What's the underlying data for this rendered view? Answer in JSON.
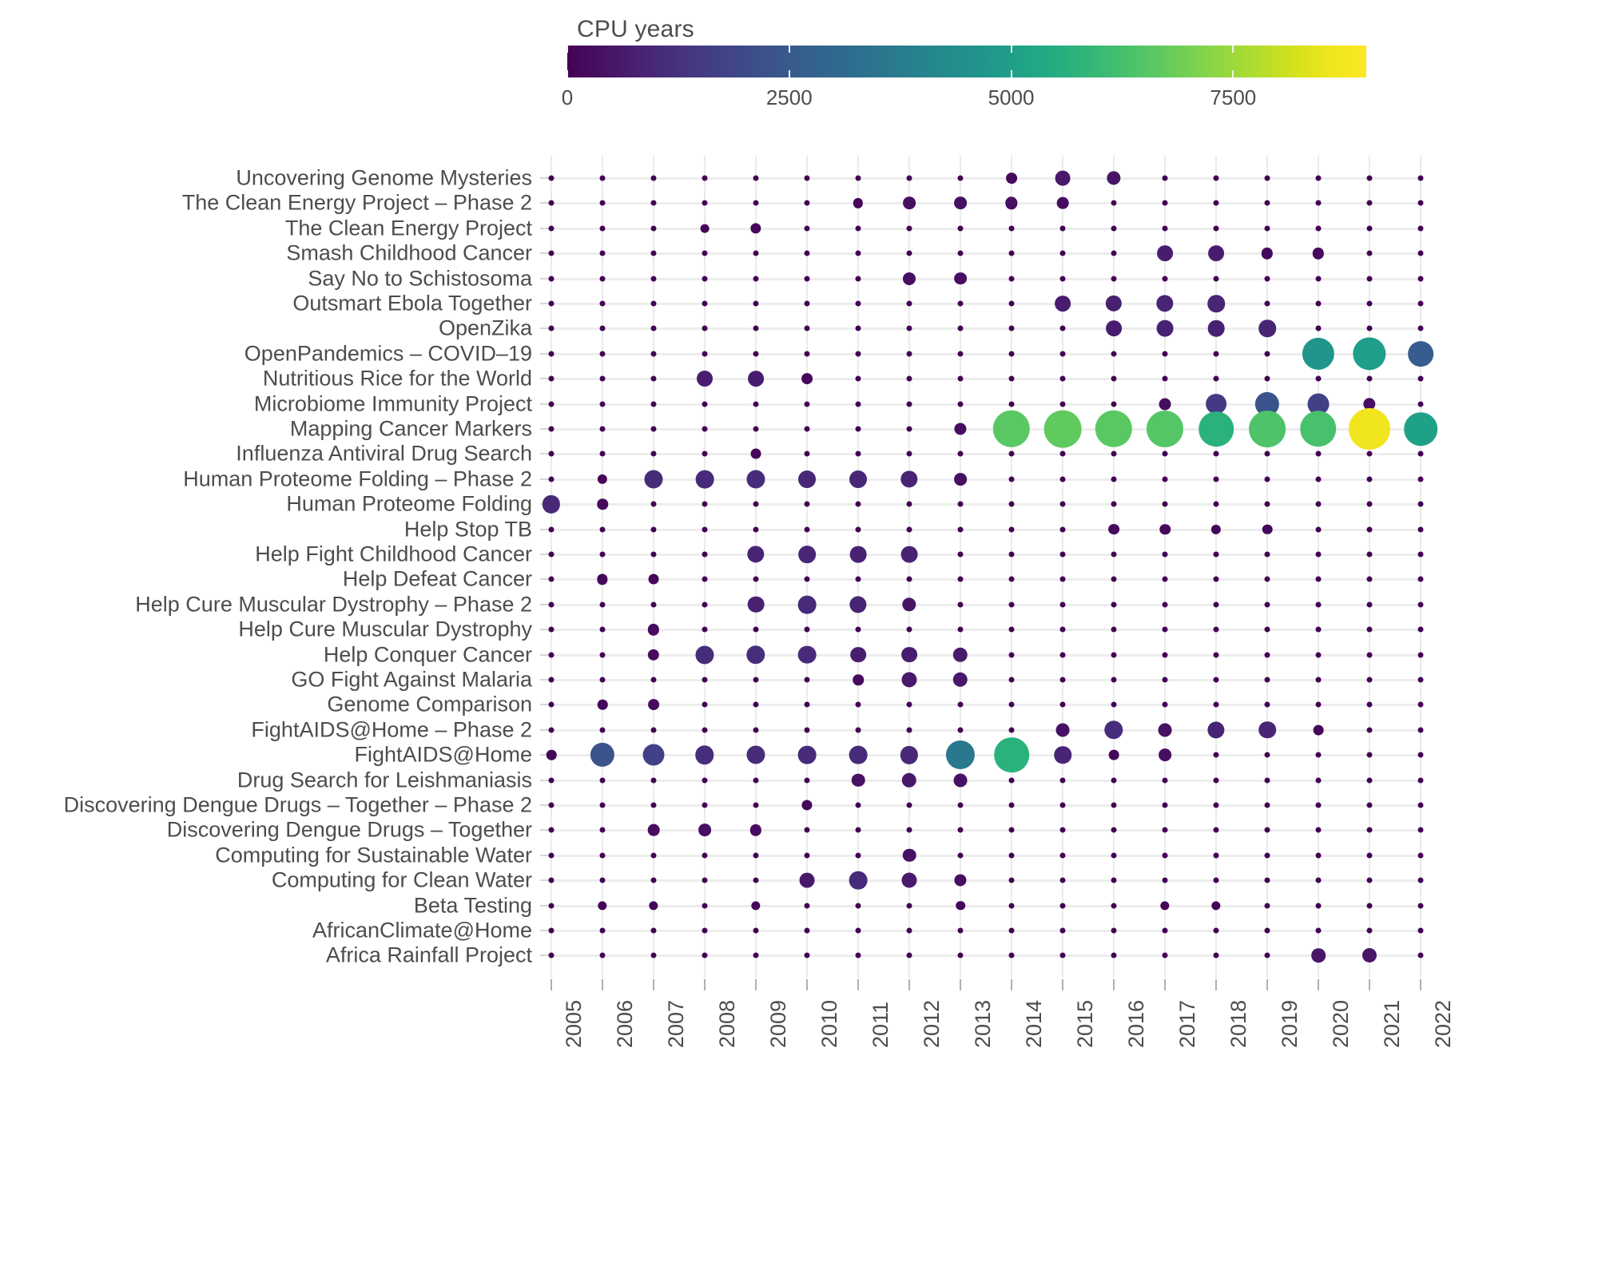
{
  "legend": {
    "title": "CPU years",
    "ticks": [
      0,
      2500,
      5000,
      7500
    ],
    "tick_labels": [
      "0",
      "2500",
      "5000",
      "7500"
    ],
    "range": [
      0,
      9000
    ],
    "colormap": "viridis",
    "colors": [
      "#440154",
      "#46327e",
      "#365c8d",
      "#277f8e",
      "#1fa187",
      "#4ac16d",
      "#a0da39",
      "#fde725"
    ]
  },
  "axes": {
    "x_label": "",
    "y_label": "",
    "x_ticks": [
      "2005",
      "2006",
      "2007",
      "2008",
      "2009",
      "2010",
      "2011",
      "2012",
      "2013",
      "2014",
      "2015",
      "2016",
      "2017",
      "2018",
      "2019",
      "2020",
      "2021",
      "2022"
    ],
    "y_ticks": [
      "Uncovering Genome Mysteries",
      "The Clean Energy Project – Phase 2",
      "The Clean Energy Project",
      "Smash Childhood Cancer",
      "Say No to Schistosoma",
      "Outsmart Ebola Together",
      "OpenZika",
      "OpenPandemics – COVID–19",
      "Nutritious Rice for the World",
      "Microbiome Immunity Project",
      "Mapping Cancer Markers",
      "Influenza Antiviral Drug Search",
      "Human Proteome Folding – Phase 2",
      "Human Proteome Folding",
      "Help Stop TB",
      "Help Fight Childhood Cancer",
      "Help Defeat Cancer",
      "Help Cure Muscular Dystrophy – Phase 2",
      "Help Cure Muscular Dystrophy",
      "Help Conquer Cancer",
      "GO Fight Against Malaria",
      "Genome Comparison",
      "FightAIDS@Home – Phase 2",
      "FightAIDS@Home",
      "Drug Search for Leishmaniasis",
      "Discovering Dengue Drugs – Together – Phase 2",
      "Discovering Dengue Drugs – Together",
      "Computing for Sustainable Water",
      "Computing for Clean Water",
      "Beta Testing",
      "AfricanClimate@Home",
      "Africa Rainfall Project"
    ]
  },
  "chart_data": {
    "type": "scatter",
    "title": "",
    "subtitle": "",
    "xlabel": "",
    "ylabel": "",
    "legend_title": "CPU years",
    "legend_position": "top",
    "grid": true,
    "size_encodes": "CPU years",
    "color_encodes": "CPU years",
    "x": [
      "2005",
      "2006",
      "2007",
      "2008",
      "2009",
      "2010",
      "2011",
      "2012",
      "2013",
      "2014",
      "2015",
      "2016",
      "2017",
      "2018",
      "2019",
      "2020",
      "2021",
      "2022"
    ],
    "categories": [
      "Uncovering Genome Mysteries",
      "The Clean Energy Project – Phase 2",
      "The Clean Energy Project",
      "Smash Childhood Cancer",
      "Say No to Schistosoma",
      "Outsmart Ebola Together",
      "OpenZika",
      "OpenPandemics – COVID–19",
      "Nutritious Rice for the World",
      "Microbiome Immunity Project",
      "Mapping Cancer Markers",
      "Influenza Antiviral Drug Search",
      "Human Proteome Folding – Phase 2",
      "Human Proteome Folding",
      "Help Stop TB",
      "Help Fight Childhood Cancer",
      "Help Defeat Cancer",
      "Help Cure Muscular Dystrophy – Phase 2",
      "Help Cure Muscular Dystrophy",
      "Help Conquer Cancer",
      "GO Fight Against Malaria",
      "Genome Comparison",
      "FightAIDS@Home – Phase 2",
      "FightAIDS@Home",
      "Drug Search for Leishmaniasis",
      "Discovering Dengue Drugs – Together – Phase 2",
      "Discovering Dengue Drugs – Together",
      "Computing for Sustainable Water",
      "Computing for Clean Water",
      "Beta Testing",
      "AfricanClimate@Home",
      "Africa Rainfall Project"
    ],
    "points": [
      {
        "project": "Uncovering Genome Mysteries",
        "year": "2014",
        "value": 200
      },
      {
        "project": "Uncovering Genome Mysteries",
        "year": "2015",
        "value": 600
      },
      {
        "project": "Uncovering Genome Mysteries",
        "year": "2016",
        "value": 450
      },
      {
        "project": "The Clean Energy Project – Phase 2",
        "year": "2011",
        "value": 120
      },
      {
        "project": "The Clean Energy Project – Phase 2",
        "year": "2012",
        "value": 330
      },
      {
        "project": "The Clean Energy Project – Phase 2",
        "year": "2013",
        "value": 330
      },
      {
        "project": "The Clean Energy Project – Phase 2",
        "year": "2014",
        "value": 300
      },
      {
        "project": "The Clean Energy Project – Phase 2",
        "year": "2015",
        "value": 250
      },
      {
        "project": "The Clean Energy Project",
        "year": "2008",
        "value": 60
      },
      {
        "project": "The Clean Energy Project",
        "year": "2009",
        "value": 170
      },
      {
        "project": "Smash Childhood Cancer",
        "year": "2017",
        "value": 700
      },
      {
        "project": "Smash Childhood Cancer",
        "year": "2018",
        "value": 700
      },
      {
        "project": "Smash Childhood Cancer",
        "year": "2019",
        "value": 230
      },
      {
        "project": "Smash Childhood Cancer",
        "year": "2020",
        "value": 230
      },
      {
        "project": "Say No to Schistosoma",
        "year": "2012",
        "value": 350
      },
      {
        "project": "Say No to Schistosoma",
        "year": "2013",
        "value": 330
      },
      {
        "project": "Outsmart Ebola Together",
        "year": "2015",
        "value": 700
      },
      {
        "project": "Outsmart Ebola Together",
        "year": "2016",
        "value": 760
      },
      {
        "project": "Outsmart Ebola Together",
        "year": "2017",
        "value": 880
      },
      {
        "project": "Outsmart Ebola Together",
        "year": "2018",
        "value": 900
      },
      {
        "project": "OpenZika",
        "year": "2016",
        "value": 700
      },
      {
        "project": "OpenZika",
        "year": "2017",
        "value": 820
      },
      {
        "project": "OpenZika",
        "year": "2018",
        "value": 790
      },
      {
        "project": "OpenZika",
        "year": "2019",
        "value": 900
      },
      {
        "project": "OpenPandemics – COVID–19",
        "year": "2020",
        "value": 4700
      },
      {
        "project": "OpenPandemics – COVID–19",
        "year": "2021",
        "value": 5000
      },
      {
        "project": "OpenPandemics – COVID–19",
        "year": "2022",
        "value": 2600
      },
      {
        "project": "Nutritious Rice for the World",
        "year": "2008",
        "value": 720
      },
      {
        "project": "Nutritious Rice for the World",
        "year": "2009",
        "value": 700
      },
      {
        "project": "Nutritious Rice for the World",
        "year": "2010",
        "value": 200
      },
      {
        "project": "Microbiome Immunity Project",
        "year": "2017",
        "value": 270
      },
      {
        "project": "Microbiome Immunity Project",
        "year": "2018",
        "value": 1500
      },
      {
        "project": "Microbiome Immunity Project",
        "year": "2019",
        "value": 2300
      },
      {
        "project": "Microbiome Immunity Project",
        "year": "2020",
        "value": 1700
      },
      {
        "project": "Microbiome Immunity Project",
        "year": "2021",
        "value": 300
      },
      {
        "project": "Mapping Cancer Markers",
        "year": "2013",
        "value": 280
      },
      {
        "project": "Mapping Cancer Markers",
        "year": "2014",
        "value": 6600
      },
      {
        "project": "Mapping Cancer Markers",
        "year": "2015",
        "value": 6700
      },
      {
        "project": "Mapping Cancer Markers",
        "year": "2016",
        "value": 6600
      },
      {
        "project": "Mapping Cancer Markers",
        "year": "2017",
        "value": 6500
      },
      {
        "project": "Mapping Cancer Markers",
        "year": "2018",
        "value": 5700
      },
      {
        "project": "Mapping Cancer Markers",
        "year": "2019",
        "value": 6400
      },
      {
        "project": "Mapping Cancer Markers",
        "year": "2020",
        "value": 6300
      },
      {
        "project": "Mapping Cancer Markers",
        "year": "2021",
        "value": 8600
      },
      {
        "project": "Mapping Cancer Markers",
        "year": "2022",
        "value": 5100
      },
      {
        "project": "Influenza Antiviral Drug Search",
        "year": "2009",
        "value": 150
      },
      {
        "project": "Human Proteome Folding – Phase 2",
        "year": "2006",
        "value": 120
      },
      {
        "project": "Human Proteome Folding – Phase 2",
        "year": "2007",
        "value": 1100
      },
      {
        "project": "Human Proteome Folding – Phase 2",
        "year": "2008",
        "value": 1050
      },
      {
        "project": "Human Proteome Folding – Phase 2",
        "year": "2009",
        "value": 1100
      },
      {
        "project": "Human Proteome Folding – Phase 2",
        "year": "2010",
        "value": 950
      },
      {
        "project": "Human Proteome Folding – Phase 2",
        "year": "2011",
        "value": 950
      },
      {
        "project": "Human Proteome Folding – Phase 2",
        "year": "2012",
        "value": 880
      },
      {
        "project": "Human Proteome Folding – Phase 2",
        "year": "2013",
        "value": 330
      },
      {
        "project": "Human Proteome Folding",
        "year": "2005",
        "value": 1000
      },
      {
        "project": "Human Proteome Folding",
        "year": "2006",
        "value": 180
      },
      {
        "project": "Help Stop TB",
        "year": "2016",
        "value": 200
      },
      {
        "project": "Help Stop TB",
        "year": "2017",
        "value": 180
      },
      {
        "project": "Help Stop TB",
        "year": "2018",
        "value": 120
      },
      {
        "project": "Help Stop TB",
        "year": "2019",
        "value": 130
      },
      {
        "project": "Help Fight Childhood Cancer",
        "year": "2009",
        "value": 880
      },
      {
        "project": "Help Fight Childhood Cancer",
        "year": "2010",
        "value": 920
      },
      {
        "project": "Help Fight Childhood Cancer",
        "year": "2011",
        "value": 800
      },
      {
        "project": "Help Fight Childhood Cancer",
        "year": "2012",
        "value": 820
      },
      {
        "project": "Help Defeat Cancer",
        "year": "2006",
        "value": 170
      },
      {
        "project": "Help Defeat Cancer",
        "year": "2007",
        "value": 150
      },
      {
        "project": "Help Cure Muscular Dystrophy – Phase 2",
        "year": "2009",
        "value": 790
      },
      {
        "project": "Help Cure Muscular Dystrophy – Phase 2",
        "year": "2010",
        "value": 1050
      },
      {
        "project": "Help Cure Muscular Dystrophy – Phase 2",
        "year": "2011",
        "value": 860
      },
      {
        "project": "Help Cure Muscular Dystrophy – Phase 2",
        "year": "2012",
        "value": 460
      },
      {
        "project": "Help Cure Muscular Dystrophy",
        "year": "2007",
        "value": 230
      },
      {
        "project": "Help Conquer Cancer",
        "year": "2007",
        "value": 230
      },
      {
        "project": "Help Conquer Cancer",
        "year": "2008",
        "value": 1100
      },
      {
        "project": "Help Conquer Cancer",
        "year": "2009",
        "value": 1150
      },
      {
        "project": "Help Conquer Cancer",
        "year": "2010",
        "value": 1050
      },
      {
        "project": "Help Conquer Cancer",
        "year": "2011",
        "value": 680
      },
      {
        "project": "Help Conquer Cancer",
        "year": "2012",
        "value": 700
      },
      {
        "project": "Help Conquer Cancer",
        "year": "2013",
        "value": 560
      },
      {
        "project": "GO Fight Against Malaria",
        "year": "2011",
        "value": 180
      },
      {
        "project": "GO Fight Against Malaria",
        "year": "2012",
        "value": 620
      },
      {
        "project": "GO Fight Against Malaria",
        "year": "2013",
        "value": 560
      },
      {
        "project": "Genome Comparison",
        "year": "2006",
        "value": 130
      },
      {
        "project": "Genome Comparison",
        "year": "2007",
        "value": 200
      },
      {
        "project": "FightAIDS@Home – Phase 2",
        "year": "2015",
        "value": 420
      },
      {
        "project": "FightAIDS@Home – Phase 2",
        "year": "2016",
        "value": 1150
      },
      {
        "project": "FightAIDS@Home – Phase 2",
        "year": "2017",
        "value": 420
      },
      {
        "project": "FightAIDS@Home – Phase 2",
        "year": "2018",
        "value": 860
      },
      {
        "project": "FightAIDS@Home – Phase 2",
        "year": "2019",
        "value": 900
      },
      {
        "project": "FightAIDS@Home – Phase 2",
        "year": "2020",
        "value": 140
      },
      {
        "project": "FightAIDS@Home",
        "year": "2005",
        "value": 130
      },
      {
        "project": "FightAIDS@Home",
        "year": "2006",
        "value": 2300
      },
      {
        "project": "FightAIDS@Home",
        "year": "2007",
        "value": 1700
      },
      {
        "project": "FightAIDS@Home",
        "year": "2008",
        "value": 1150
      },
      {
        "project": "FightAIDS@Home",
        "year": "2009",
        "value": 1100
      },
      {
        "project": "FightAIDS@Home",
        "year": "2010",
        "value": 1050
      },
      {
        "project": "FightAIDS@Home",
        "year": "2011",
        "value": 1050
      },
      {
        "project": "FightAIDS@Home",
        "year": "2012",
        "value": 1000
      },
      {
        "project": "FightAIDS@Home",
        "year": "2013",
        "value": 3600
      },
      {
        "project": "FightAIDS@Home",
        "year": "2014",
        "value": 5700
      },
      {
        "project": "FightAIDS@Home",
        "year": "2015",
        "value": 900
      },
      {
        "project": "FightAIDS@Home",
        "year": "2016",
        "value": 140
      },
      {
        "project": "FightAIDS@Home",
        "year": "2017",
        "value": 330
      },
      {
        "project": "Drug Search for Leishmaniasis",
        "year": "2011",
        "value": 390
      },
      {
        "project": "Drug Search for Leishmaniasis",
        "year": "2012",
        "value": 560
      },
      {
        "project": "Drug Search for Leishmaniasis",
        "year": "2013",
        "value": 420
      },
      {
        "project": "Discovering Dengue Drugs – Together – Phase 2",
        "year": "2010",
        "value": 160
      },
      {
        "project": "Discovering Dengue Drugs – Together",
        "year": "2007",
        "value": 250
      },
      {
        "project": "Discovering Dengue Drugs – Together",
        "year": "2008",
        "value": 330
      },
      {
        "project": "Discovering Dengue Drugs – Together",
        "year": "2009",
        "value": 230
      },
      {
        "project": "Computing for Sustainable Water",
        "year": "2012",
        "value": 390
      },
      {
        "project": "Computing for Clean Water",
        "year": "2010",
        "value": 600
      },
      {
        "project": "Computing for Clean Water",
        "year": "2011",
        "value": 1050
      },
      {
        "project": "Computing for Clean Water",
        "year": "2012",
        "value": 620
      },
      {
        "project": "Computing for Clean Water",
        "year": "2013",
        "value": 280
      },
      {
        "project": "Beta Testing",
        "year": "2006",
        "value": 80
      },
      {
        "project": "Beta Testing",
        "year": "2007",
        "value": 80
      },
      {
        "project": "Beta Testing",
        "year": "2009",
        "value": 80
      },
      {
        "project": "Beta Testing",
        "year": "2013",
        "value": 90
      },
      {
        "project": "Beta Testing",
        "year": "2017",
        "value": 80
      },
      {
        "project": "Beta Testing",
        "year": "2018",
        "value": 80
      },
      {
        "project": "Africa Rainfall Project",
        "year": "2020",
        "value": 480
      },
      {
        "project": "Africa Rainfall Project",
        "year": "2021",
        "value": 520
      }
    ]
  }
}
